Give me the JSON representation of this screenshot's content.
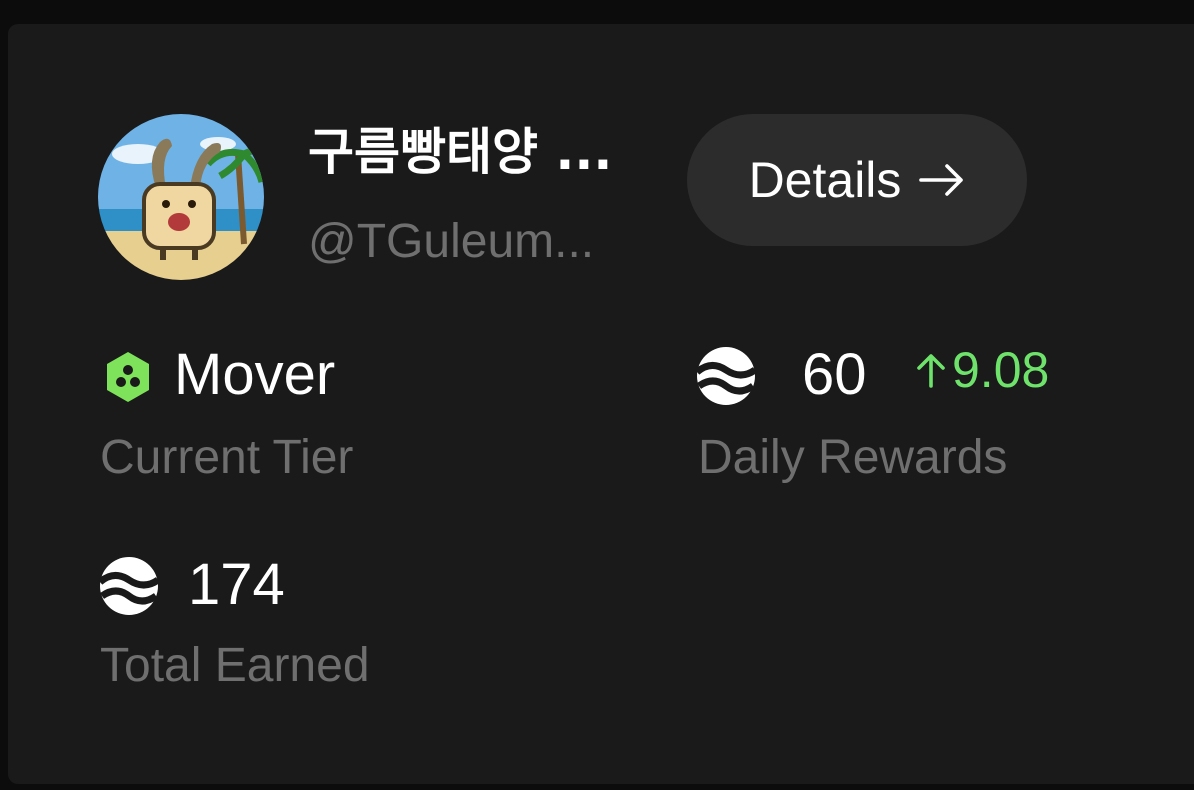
{
  "profile": {
    "display_name": "구름빵태양 ...",
    "handle": "@TGuleum..."
  },
  "details_button": {
    "label": "Details",
    "icon": "arrow-right-icon"
  },
  "stats": {
    "tier": {
      "value": "Mover",
      "label": "Current Tier",
      "icon": "tier-badge-icon",
      "icon_color": "#7ee35b"
    },
    "daily_rewards": {
      "value": "60",
      "change": "9.08",
      "change_icon": "arrow-up-icon",
      "change_color": "#6ee26b",
      "label": "Daily Rewards",
      "icon": "token-icon"
    },
    "total_earned": {
      "value": "174",
      "label": "Total Earned",
      "icon": "token-icon"
    }
  },
  "colors": {
    "background": "#1a1a1a",
    "button_bg": "#2c2c2c",
    "muted_text": "#6f6f6f",
    "positive": "#6ee26b"
  }
}
